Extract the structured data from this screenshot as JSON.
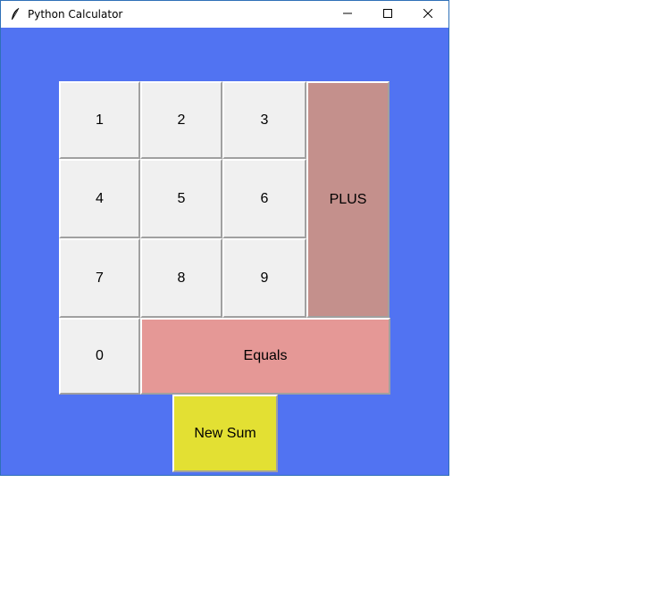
{
  "window": {
    "title": "Python Calculator",
    "app_icon": "feather-icon",
    "controls": [
      "minimize-icon",
      "maximize-icon",
      "close-icon"
    ]
  },
  "keypad": {
    "digits": [
      "1",
      "2",
      "3",
      "4",
      "5",
      "6",
      "7",
      "8",
      "9",
      "0"
    ],
    "plus_label": "PLUS",
    "equals_label": "Equals",
    "new_sum_label": "New Sum"
  },
  "colors": {
    "window_background": "#5173f2",
    "digit_button": "#f0f0f0",
    "plus_button": "#c4908c",
    "equals_button": "#e59896",
    "new_sum_button": "#e3e033"
  }
}
